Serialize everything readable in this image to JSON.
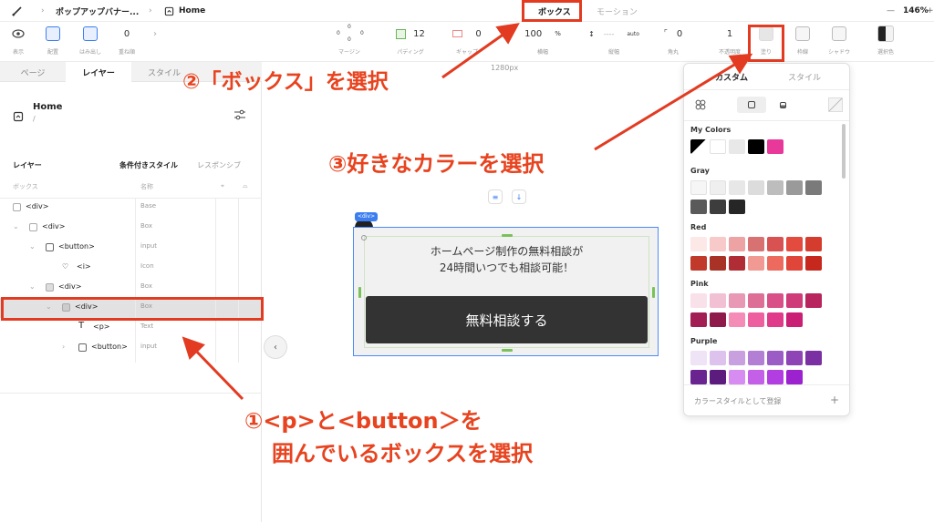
{
  "topbar": {
    "breadcrumb_file": "ポップアップバナー...",
    "breadcrumb_page": "Home",
    "tab_box": "ボックス",
    "tab_motion": "モーション",
    "zoom": "146%",
    "minus": "—",
    "plus": "+"
  },
  "toolbar": {
    "display_label": "表示",
    "layout_label": "配置",
    "overflow_label": "はみ出し",
    "zindex_value": "0",
    "zindex_label": "重ね順",
    "margin_top": "0",
    "margin_left": "0",
    "margin_right": "0",
    "margin_bottom": "0",
    "margin_label": "マージン",
    "padding_value": "12",
    "padding_label": "パディング",
    "gap_value": "0",
    "gap_label": "ギャップ",
    "width_value": "100",
    "width_unit": "%",
    "width_label": "横幅",
    "height_value": "----",
    "height_unit": "auto",
    "height_label": "縦幅",
    "radius_value": "0",
    "radius_label": "角丸",
    "opacity_value": "1",
    "opacity_label": "不透明度",
    "fill_label": "塗り",
    "border_label": "枠線",
    "shadow_label": "シャドウ",
    "selected_color_label": "選択色"
  },
  "left_panel": {
    "tabs": [
      "ページ",
      "レイヤー",
      "スタイル"
    ],
    "page_title": "Home",
    "page_path": "/",
    "layer_title": "レイヤー",
    "conditional_style": "条件付きスタイル",
    "responsive": "レスポンシブ",
    "col_box": "ボックス",
    "col_name": "名称",
    "rows": [
      {
        "tag": "<div>",
        "type": "Base"
      },
      {
        "tag": "<div>",
        "type": "Box"
      },
      {
        "tag": "<button>",
        "type": "input"
      },
      {
        "tag": "<i>",
        "type": "Icon"
      },
      {
        "tag": "<div>",
        "type": "Box"
      },
      {
        "tag": "<div>",
        "type": "Box"
      },
      {
        "tag": "<p>",
        "type": "Text"
      },
      {
        "tag": "<button>",
        "type": "input"
      }
    ]
  },
  "canvas": {
    "size_label": "1280px",
    "div_tag": "<div>",
    "text_line1": "ホームページ制作の無料相談が",
    "text_line2": "24時間いつでも相談可能！",
    "cta_label": "無料相談する"
  },
  "color_panel": {
    "tab_custom": "カスタム",
    "tab_style": "スタイル",
    "groups": [
      {
        "name": "My Colors",
        "colors": [
          "#000000",
          "#ffffff",
          "#e8e8e8",
          "#000000",
          "#e8389a"
        ]
      },
      {
        "name": "Gray",
        "colors": [
          "#f6f6f6",
          "#efefef",
          "#e7e7e7",
          "#dcdcdc",
          "#bdbdbd",
          "#9a9a9a",
          "#7a7a7a",
          "#5a5a5a",
          "#3d3d3d",
          "#262626"
        ]
      },
      {
        "name": "Red",
        "colors": [
          "#fde8e8",
          "#f7c9c9",
          "#eda3a3",
          "#d87272",
          "#d85252",
          "#e24b3e",
          "#d43d2e",
          "#c0392b",
          "#a83226",
          "#b02d35",
          "#f09a93",
          "#ec6a5e",
          "#e0453a",
          "#c6281d"
        ]
      },
      {
        "name": "Pink",
        "colors": [
          "#f9e1ea",
          "#f2c0d3",
          "#e897b5",
          "#dd6f97",
          "#d94f87",
          "#cf3a78",
          "#b8245e",
          "#a21d54",
          "#8e1a4b",
          "#f58cb8",
          "#ee5fa0",
          "#e03a8a",
          "#c91f74"
        ]
      },
      {
        "name": "Purple",
        "colors": [
          "#efe3f6",
          "#dcc2ec",
          "#c8a0e0",
          "#b27fd4",
          "#9c5cc6",
          "#8e44b5",
          "#7a2fa3",
          "#6a2490",
          "#5b1c7e",
          "#d68cf0",
          "#c45fe8",
          "#b23de0",
          "#9c22cf"
        ]
      }
    ],
    "footer_text": "カラースタイルとして登録",
    "footer_plus": "+"
  },
  "annotations": {
    "step1_line1": "①<p>と<button＞を",
    "step1_line2": "囲んでいるボックスを選択",
    "step2": "②「ボックス」を選択",
    "step3": "③好きなカラーを選択",
    "color": "#e8431f"
  }
}
